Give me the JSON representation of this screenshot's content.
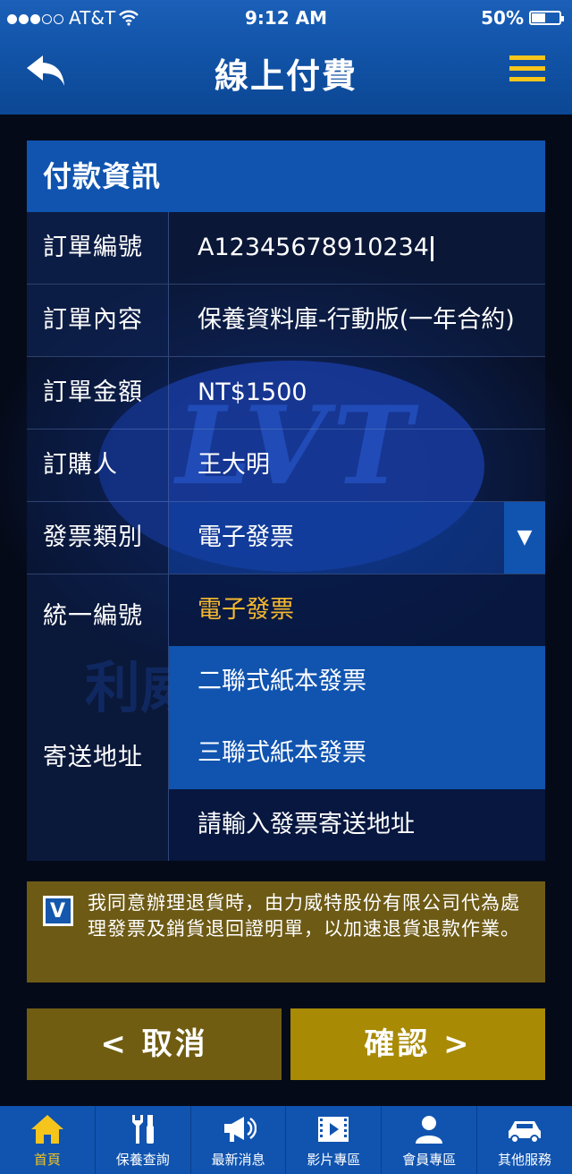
{
  "status_bar": {
    "carrier": "AT&T",
    "time": "9:12 AM",
    "battery": "50%",
    "battery_level": 0.5
  },
  "header": {
    "title": "線上付費"
  },
  "panel": {
    "title": "付款資訊",
    "rows": [
      {
        "label": "訂單編號",
        "value": "A12345678910234"
      },
      {
        "label": "訂單內容",
        "value": "保養資料庫-行動版(一年合約)"
      },
      {
        "label": "訂單金額",
        "value": "NT$1500"
      },
      {
        "label": "訂購人",
        "value": "王大明"
      },
      {
        "label": "發票類別",
        "value": "電子發票"
      },
      {
        "label": "統一編號"
      },
      {
        "label": "寄送地址"
      }
    ],
    "dropdown_options": [
      "電子發票",
      "二聯式紙本發票",
      "三聯式紙本發票"
    ],
    "address_placeholder": "請輸入發票寄送地址"
  },
  "agreement": {
    "checked": true,
    "check_mark": "V",
    "text": "我同意辦理退貨時，由力威特股份有限公司代為處理發票及銷貨退回證明單，以加速退貨退款作業。"
  },
  "buttons": {
    "cancel": "<  取消",
    "confirm": "確認  >"
  },
  "tabbar": {
    "items": [
      {
        "label": "首頁",
        "icon": "home-icon",
        "active": true
      },
      {
        "label": "保養查詢",
        "icon": "tools-icon"
      },
      {
        "label": "最新消息",
        "icon": "megaphone-icon"
      },
      {
        "label": "影片專區",
        "icon": "film-icon"
      },
      {
        "label": "會員專區",
        "icon": "user-icon"
      },
      {
        "label": "其他服務",
        "icon": "car-icon"
      }
    ]
  },
  "background": {
    "logo_text": "LVT",
    "watermark_text": "利威"
  },
  "colors": {
    "header_blue": "#1457ad",
    "accent_yellow": "#f6c51c",
    "confirm_gold": "#a88a05",
    "cancel_gold": "#705d12"
  }
}
